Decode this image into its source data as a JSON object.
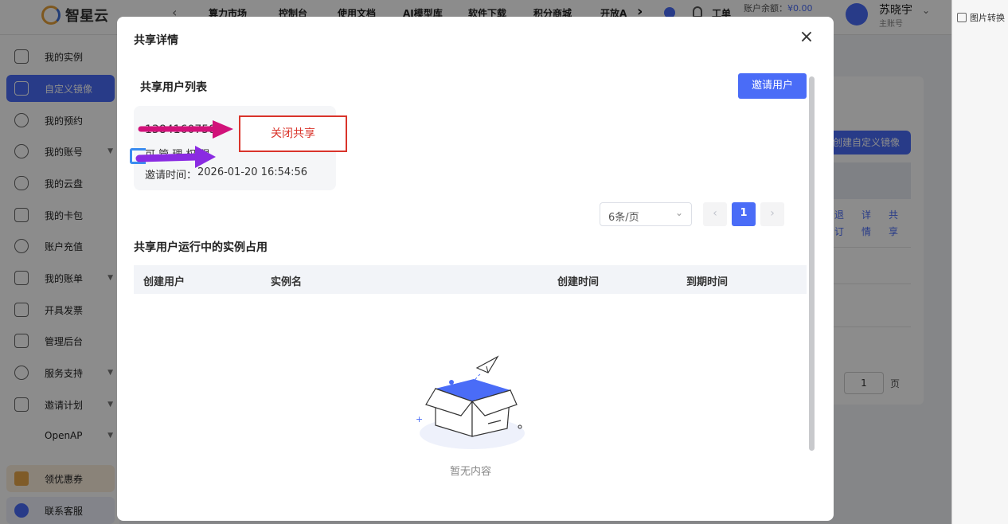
{
  "header": {
    "logo_text": "智星云",
    "nav_items": [
      "算力市场",
      "控制台",
      "使用文档",
      "AI模型库",
      "软件下载",
      "积分商城",
      "开放A"
    ],
    "ticket_label": "工单",
    "balance_label": "账户余额：",
    "balance_value": "¥0.00",
    "user_name": "苏晓宇",
    "user_role": "主账号"
  },
  "sidebar": {
    "items": [
      {
        "label": "我的实例"
      },
      {
        "label": "自定义镜像"
      },
      {
        "label": "我的预约"
      },
      {
        "label": "我的账号"
      },
      {
        "label": "我的云盘"
      },
      {
        "label": "我的卡包"
      },
      {
        "label": "账户充值"
      },
      {
        "label": "我的账单"
      },
      {
        "label": "开具发票"
      },
      {
        "label": "管理后台"
      },
      {
        "label": "服务支持"
      },
      {
        "label": "邀请计划"
      },
      {
        "label": "OpenAP"
      },
      {
        "label": "领优惠券"
      },
      {
        "label": "联系客服"
      }
    ]
  },
  "background": {
    "create_button": "创建自定义镜像",
    "actions": [
      "退订",
      "详情",
      "共享"
    ],
    "pager_input": "1",
    "pager_suffix": "页"
  },
  "right_strip": {
    "item_label": "图片转换"
  },
  "modal": {
    "title": "共享详情",
    "shared_users_title": "共享用户列表",
    "invite_button": "邀请用户",
    "user_card": {
      "phone": "1384160758",
      "permission": "可  管  理  权  限",
      "invite_time_label": "邀请时间：",
      "invite_time": "2026-01-20 16:54:56"
    },
    "close_share_button": "关闭共享",
    "page_size": "6条/页",
    "current_page": "1",
    "running_instances_title": "共享用户运行中的实例占用",
    "table_columns": [
      "创建用户",
      "实例名",
      "创建时间",
      "到期时间"
    ],
    "empty_text": "暂无内容"
  },
  "colors": {
    "primary": "#4a6cf7",
    "annotation_red": "#d9342b",
    "arrow_magenta": "#d1127a",
    "arrow_purple": "#8a2be2"
  }
}
